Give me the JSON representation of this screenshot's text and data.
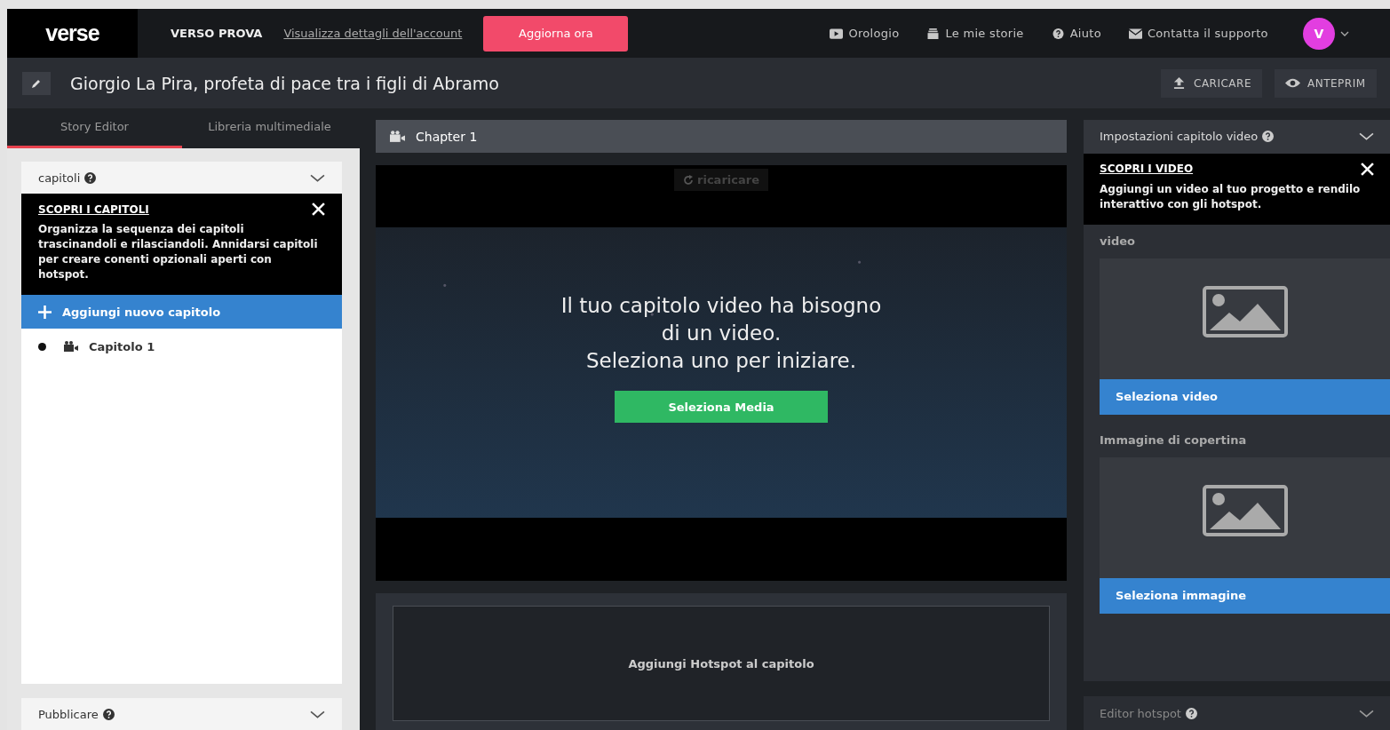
{
  "topbar": {
    "logo": "verse",
    "plan": "VERSO PROVA",
    "account_link": "Visualizza dettagli dell'account",
    "upgrade_button": "Aggiorna ora",
    "nav": [
      {
        "label": "Orologio",
        "kind": "video"
      },
      {
        "label": "Le mie storie",
        "kind": "stack"
      },
      {
        "label": "Aiuto",
        "kind": "help"
      },
      {
        "label": "Contatta il supporto",
        "kind": "mail"
      }
    ],
    "avatar": "V"
  },
  "title_bar": {
    "title": "Giorgio La Pira, profeta di pace tra i figli di Abramo",
    "actions": [
      {
        "label": "CARICARE",
        "kind": "upload"
      },
      {
        "label": "ANTEPRIM",
        "kind": "eye"
      }
    ]
  },
  "left_panel": {
    "tabs": [
      {
        "label": "Story Editor",
        "selected": true
      },
      {
        "label": "Libreria multimediale",
        "selected": false
      }
    ],
    "chapters_section": {
      "title": "capitoli",
      "expanded": true,
      "tip": {
        "title": "SCOPRI I CAPITOLI",
        "text": "Organizza la sequenza dei capitoli trascinandoli e rilasciandoli. Annidarsi capitoli per creare conenti opzionali aperti con hotspot."
      },
      "add_button": "Aggiungi nuovo capitolo",
      "tree": [
        {
          "label": "Capitolo 1"
        }
      ]
    },
    "publish_section": {
      "title": "Pubblicare"
    }
  },
  "center": {
    "chapter_title": "Chapter 1",
    "reload_button": "ricaricare",
    "message": [
      "Il tuo capitolo video ha bisogno",
      "di un video.",
      "Seleziona uno per iniziare."
    ],
    "select_media_button": "Seleziona Media",
    "hotspot_area": "Aggiungi Hotspot al capitolo"
  },
  "right_panel": {
    "settings_title": "Impostazioni capitolo video",
    "expanded": true,
    "tip": {
      "title": "SCOPRI I VIDEO",
      "text": "Aggiungi un video al tuo progetto e rendilo interattivo con gli hotspot."
    },
    "media_fields": [
      {
        "label": "video",
        "button": "Seleziona video"
      },
      {
        "label": "Immagine di copertina",
        "button": "Seleziona immagine"
      }
    ],
    "hotspot_editor": {
      "title": "Editor hotspot"
    }
  }
}
